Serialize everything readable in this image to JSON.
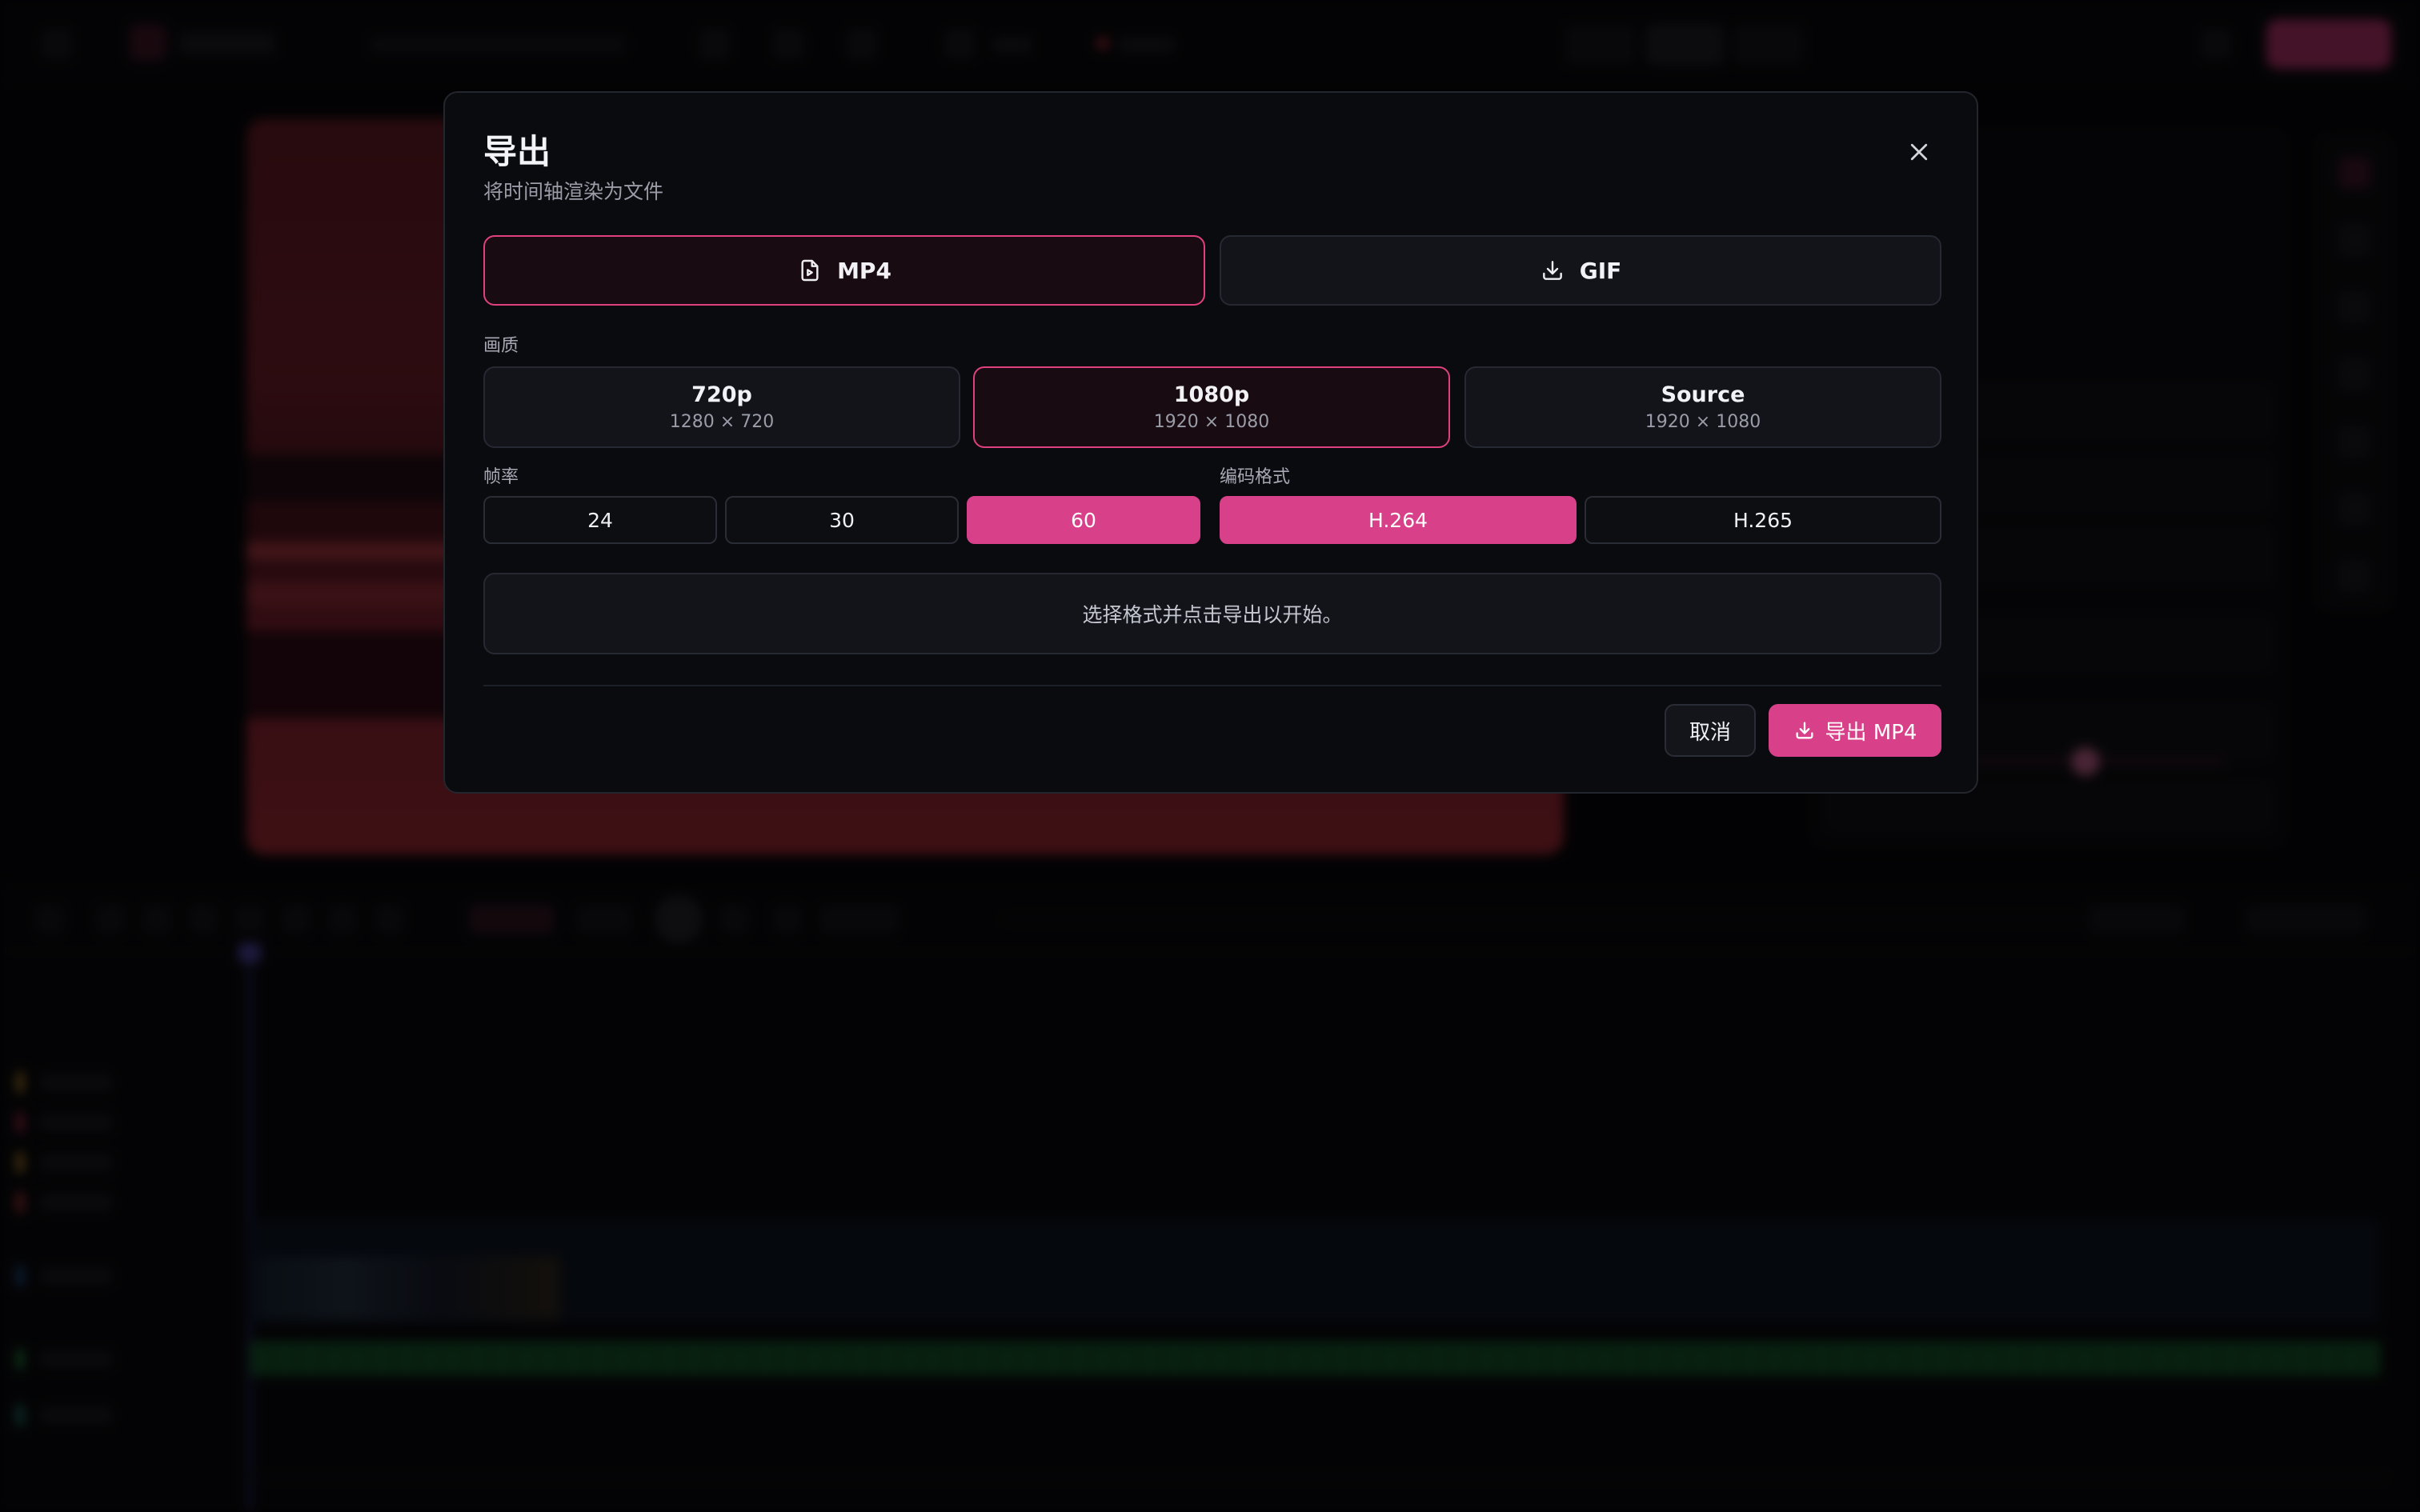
{
  "dialog": {
    "title": "导出",
    "subtitle": "将时间轴渲染为文件",
    "close_icon": "close-icon"
  },
  "formats": [
    {
      "label": "MP4",
      "icon": "file-video-icon",
      "selected": true
    },
    {
      "label": "GIF",
      "icon": "download-icon",
      "selected": false
    }
  ],
  "quality": {
    "label": "画质",
    "options": [
      {
        "name": "720p",
        "resolution": "1280 × 720",
        "selected": false
      },
      {
        "name": "1080p",
        "resolution": "1920 × 1080",
        "selected": true
      },
      {
        "name": "Source",
        "resolution": "1920 × 1080",
        "selected": false
      }
    ]
  },
  "framerate": {
    "label": "帧率",
    "options": [
      "24",
      "30",
      "60"
    ],
    "selected": "60"
  },
  "codec": {
    "label": "编码格式",
    "options": [
      "H.264",
      "H.265"
    ],
    "selected": "H.264"
  },
  "status_text": "选择格式并点击导出以开始。",
  "actions": {
    "cancel_label": "取消",
    "export_label": "导出 MP4"
  },
  "colors": {
    "accent": "#d8408a",
    "accent_border": "#e0407e",
    "modal_bg": "#0a0b0f"
  }
}
